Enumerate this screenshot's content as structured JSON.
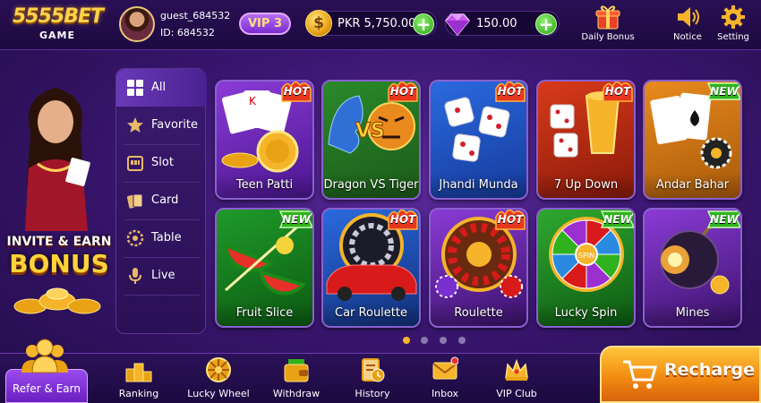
{
  "brand": {
    "logo_main": "5555BET",
    "logo_sub": "GAME"
  },
  "user": {
    "name": "guest_684532",
    "id": "ID: 684532",
    "vip": "VIP 3"
  },
  "balances": {
    "cash": "PKR 5,750.00",
    "gems": "150.00"
  },
  "top_actions": [
    {
      "label": "Daily Bonus",
      "icon": "gift-icon"
    },
    {
      "label": "Notice",
      "icon": "speaker-icon"
    },
    {
      "label": "Setting",
      "icon": "gear-icon"
    }
  ],
  "promo": {
    "line1": "INVITE & EARN",
    "line2": "BONUS"
  },
  "categories": [
    {
      "label": "All",
      "icon": "grid-icon",
      "active": true
    },
    {
      "label": "Favorite",
      "icon": "star-icon"
    },
    {
      "label": "Slot",
      "icon": "slot-machine-icon"
    },
    {
      "label": "Card",
      "icon": "cards-icon"
    },
    {
      "label": "Table",
      "icon": "roulette-wheel-icon"
    },
    {
      "label": "Live",
      "icon": "microphone-icon"
    }
  ],
  "games": [
    {
      "name": "Teen Patti",
      "tag": "HOT"
    },
    {
      "name": "Dragon VS Tiger",
      "tag": "HOT"
    },
    {
      "name": "Jhandi Munda",
      "tag": "HOT"
    },
    {
      "name": "7 Up Down",
      "tag": "HOT"
    },
    {
      "name": "Andar Bahar",
      "tag": "NEW"
    },
    {
      "name": "Fruit Slice",
      "tag": "NEW"
    },
    {
      "name": "Car Roulette",
      "tag": "HOT"
    },
    {
      "name": "Roulette",
      "tag": "HOT"
    },
    {
      "name": "Lucky Spin",
      "tag": "NEW"
    },
    {
      "name": "Mines",
      "tag": "NEW"
    }
  ],
  "art_text": {
    "versus": "VS",
    "spin": "SPIN"
  },
  "pagination": {
    "pages": 4,
    "current": 1
  },
  "bottom_nav": [
    {
      "label": "Ranking",
      "icon": "podium-icon"
    },
    {
      "label": "Lucky Wheel",
      "icon": "wheel-icon"
    },
    {
      "label": "Withdraw",
      "icon": "wallet-icon"
    },
    {
      "label": "History",
      "icon": "clipboard-clock-icon"
    },
    {
      "label": "Inbox",
      "icon": "envelope-icon"
    },
    {
      "label": "VIP Club",
      "icon": "crown-icon"
    }
  ],
  "refer": {
    "label": "Refer & Earn"
  },
  "recharge": {
    "label": "Recharge"
  },
  "colors": {
    "hot": "#e8371f",
    "new": "#2fb21e",
    "accent": "#f5b42a",
    "bg": "#3a1670"
  }
}
